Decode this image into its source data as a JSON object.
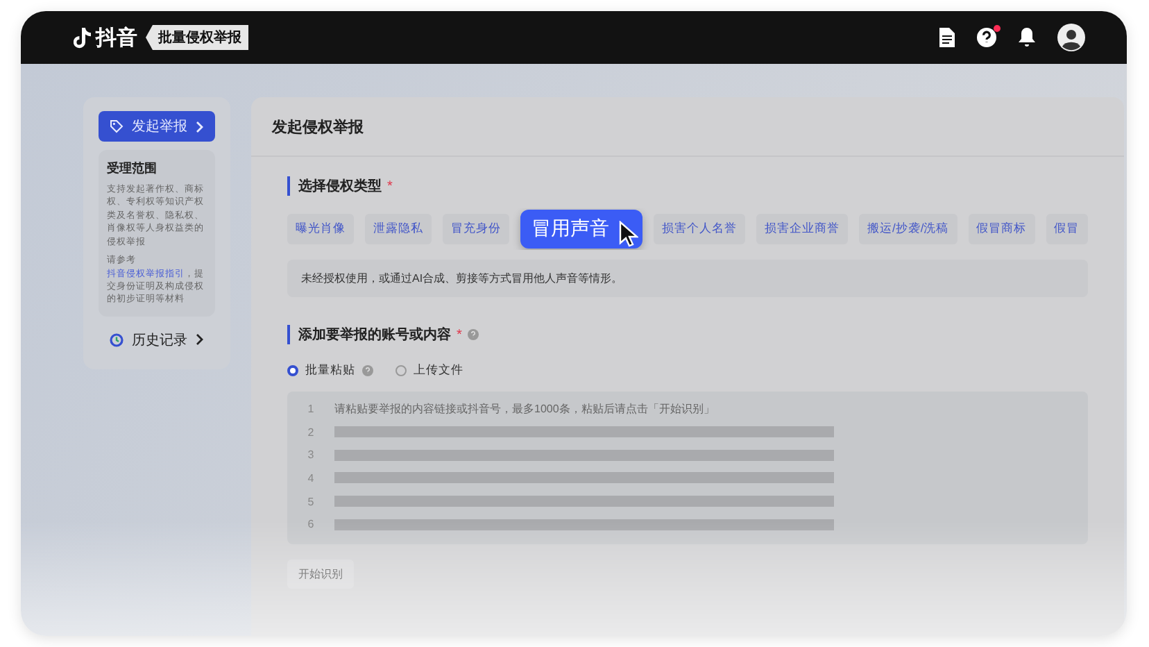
{
  "top_bar": {
    "logo_text": "抖音",
    "badge": "批量侵权举报",
    "help_dot": true
  },
  "sidebar": {
    "primary": {
      "label": "发起举报",
      "selected": true
    },
    "info": {
      "title": "受理范围",
      "description": "支持发起著作权、商标权、专利权等知识产权类及名誉权、隐私权、肖像权等人身权益类的侵权举报",
      "guide_before": "请参考",
      "guide_link": "抖音侵权举报指引",
      "guide_after": "，提交身份证明及构成侵权的初步证明等材料"
    },
    "history": {
      "label": "历史记录",
      "selected": false
    }
  },
  "main": {
    "title": "发起侵权举报",
    "type_section": {
      "title": "选择侵权类型",
      "required_mark": "*",
      "tags": [
        {
          "label": "曝光肖像",
          "selected": false
        },
        {
          "label": "泄露隐私",
          "selected": false
        },
        {
          "label": "冒充身份",
          "selected": false
        },
        {
          "label": "冒用声音",
          "selected": true
        },
        {
          "label": "损害个人名誉",
          "selected": false
        },
        {
          "label": "损害企业商誉",
          "selected": false
        },
        {
          "label": "搬运/抄袭/洗稿",
          "selected": false
        },
        {
          "label": "假冒商标",
          "selected": false
        },
        {
          "label": "假冒",
          "selected": false
        }
      ],
      "description": "未经授权使用，或通过AI合成、剪接等方式冒用他人声音等情形。"
    },
    "content_section": {
      "title": "添加要举报的账号或内容",
      "required_mark": "*",
      "modes": [
        {
          "label": "批量粘贴",
          "selected": true,
          "help": true
        },
        {
          "label": "上传文件",
          "selected": false,
          "help": false
        }
      ],
      "lines": [
        {
          "number": "1",
          "kind": "text",
          "text": "请粘贴要举报的内容链接或抖音号，最多1000条，粘贴后请点击「开始识别」"
        },
        {
          "number": "2",
          "kind": "redacted"
        },
        {
          "number": "3",
          "kind": "redacted"
        },
        {
          "number": "4",
          "kind": "redacted"
        },
        {
          "number": "5",
          "kind": "redacted"
        },
        {
          "number": "6",
          "kind": "redacted"
        }
      ],
      "button": "开始识别"
    }
  }
}
